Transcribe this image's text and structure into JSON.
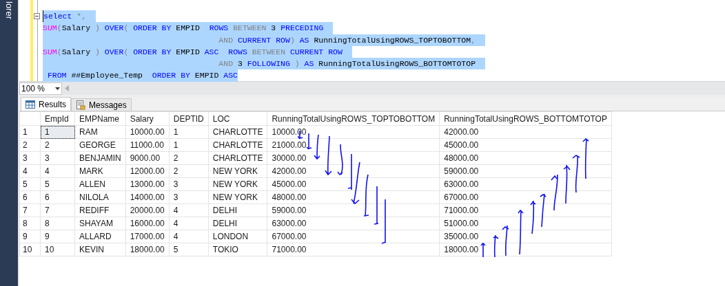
{
  "side_panel": {
    "title": "lorer"
  },
  "editor": {
    "lines": [
      [
        {
          "t": "select",
          "kind": "keyword"
        },
        {
          "t": " *,",
          "kind": "operator"
        }
      ],
      [
        {
          "t": "SUM",
          "kind": "function"
        },
        {
          "t": "(",
          "kind": "operator"
        },
        {
          "t": "Salary",
          "kind": "plain"
        },
        {
          "t": " ) ",
          "kind": "operator"
        },
        {
          "t": "OVER",
          "kind": "keyword"
        },
        {
          "t": "( ",
          "kind": "operator"
        },
        {
          "t": "ORDER BY",
          "kind": "keyword"
        },
        {
          "t": " EMPID  ",
          "kind": "plain"
        },
        {
          "t": "ROWS ",
          "kind": "keyword"
        },
        {
          "t": "BETWEEN",
          "kind": "operator"
        },
        {
          "t": " 3 ",
          "kind": "plain"
        },
        {
          "t": "PRECEDING",
          "kind": "keyword"
        }
      ],
      [
        {
          "t": "                                     AND ",
          "kind": "operator"
        },
        {
          "t": "CURRENT ROW",
          "kind": "keyword"
        },
        {
          "t": ") ",
          "kind": "operator"
        },
        {
          "t": "AS",
          "kind": "keyword"
        },
        {
          "t": " RunningTotalUsingROWS_TOPTOBOTTOM",
          "kind": "plain"
        },
        {
          "t": ",",
          "kind": "operator"
        }
      ],
      [
        {
          "t": "SUM",
          "kind": "function"
        },
        {
          "t": "(",
          "kind": "operator"
        },
        {
          "t": "Salary",
          "kind": "plain"
        },
        {
          "t": " ) ",
          "kind": "operator"
        },
        {
          "t": "OVER",
          "kind": "keyword"
        },
        {
          "t": "( ",
          "kind": "operator"
        },
        {
          "t": "ORDER BY",
          "kind": "keyword"
        },
        {
          "t": " EMPID ",
          "kind": "plain"
        },
        {
          "t": "ASC  ROWS ",
          "kind": "keyword"
        },
        {
          "t": "BETWEEN ",
          "kind": "operator"
        },
        {
          "t": "CURRENT ROW",
          "kind": "keyword"
        }
      ],
      [
        {
          "t": "                                     AND",
          "kind": "operator"
        },
        {
          "t": " 3 ",
          "kind": "plain"
        },
        {
          "t": "FOLLOWING",
          "kind": "keyword"
        },
        {
          "t": " ) ",
          "kind": "operator"
        },
        {
          "t": "AS",
          "kind": "keyword"
        },
        {
          "t": " RunningTotalUsingROWS_BOTTOMTOTOP",
          "kind": "plain"
        }
      ],
      [
        {
          "t": " FROM",
          "kind": "keyword"
        },
        {
          "t": " ##Employee_Temp  ",
          "kind": "plain"
        },
        {
          "t": "ORDER BY",
          "kind": "keyword"
        },
        {
          "t": " EMPID ",
          "kind": "plain"
        },
        {
          "t": "ASC",
          "kind": "keyword"
        }
      ]
    ]
  },
  "zoom": {
    "value": "100 %"
  },
  "tabs": [
    {
      "label": "Results",
      "selected": true
    },
    {
      "label": "Messages",
      "selected": false
    }
  ],
  "table": {
    "columns": [
      "EmpId",
      "EMPName",
      "Salary",
      "DEPTID",
      "LOC",
      "RunningTotalUsingROWS_TOPTOBOTTOM",
      "RunningTotalUsingROWS_BOTTOMTOTOP"
    ],
    "rows": [
      {
        "number": "1",
        "focused": true,
        "cells": [
          "1",
          "RAM",
          "10000.00",
          "1",
          "CHARLOTTE",
          "10000.00",
          "42000.00"
        ]
      },
      {
        "number": "2",
        "focused": false,
        "cells": [
          "2",
          "GEORGE",
          "11000.00",
          "1",
          "CHARLOTTE",
          "21000.00",
          "45000.00"
        ]
      },
      {
        "number": "3",
        "focused": false,
        "cells": [
          "3",
          "BENJAMIN",
          "9000.00",
          "2",
          "CHARLOTTE",
          "30000.00",
          "48000.00"
        ]
      },
      {
        "number": "4",
        "focused": false,
        "cells": [
          "4",
          "MARK",
          "12000.00",
          "2",
          "NEW YORK",
          "42000.00",
          "59000.00"
        ]
      },
      {
        "number": "5",
        "focused": false,
        "cells": [
          "5",
          "ALLEN",
          "13000.00",
          "3",
          "NEW YORK",
          "45000.00",
          "63000.00"
        ]
      },
      {
        "number": "6",
        "focused": false,
        "cells": [
          "6",
          "NILOLA",
          "14000.00",
          "3",
          "NEW YORK",
          "48000.00",
          "67000.00"
        ]
      },
      {
        "number": "7",
        "focused": false,
        "cells": [
          "7",
          "REDIFF",
          "20000.00",
          "4",
          "DELHI",
          "59000.00",
          "71000.00"
        ]
      },
      {
        "number": "8",
        "focused": false,
        "cells": [
          "8",
          "SHAYAM",
          "16000.00",
          "4",
          "DELHI",
          "63000.00",
          "51000.00"
        ]
      },
      {
        "number": "9",
        "focused": false,
        "cells": [
          "9",
          "ALLARD",
          "17000.00",
          "4",
          "LONDON",
          "67000.00",
          "35000.00"
        ]
      },
      {
        "number": "10",
        "focused": false,
        "cells": [
          "10",
          "KEVIN",
          "18000.00",
          "5",
          "TOKIO",
          "71000.00",
          "18000.00"
        ]
      }
    ]
  }
}
